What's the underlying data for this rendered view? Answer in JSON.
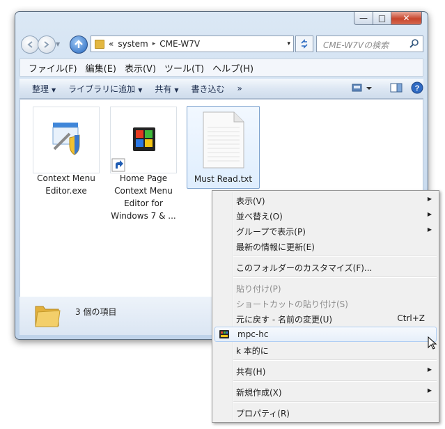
{
  "window": {
    "caption_buttons": {
      "min": "—",
      "max": "□",
      "close": "✕"
    }
  },
  "address": {
    "chevron": "«",
    "segments": [
      "system",
      "CME-W7V"
    ],
    "separator": "▸",
    "dropdown": "▾"
  },
  "search": {
    "placeholder": "CME-W7Vの検索"
  },
  "menubar": [
    "ファイル(F)",
    "編集(E)",
    "表示(V)",
    "ツール(T)",
    "ヘルプ(H)"
  ],
  "toolbar": {
    "items": [
      "整理",
      "ライブラリに追加",
      "共有",
      "書き込む"
    ],
    "more": "»",
    "arrow": "▼"
  },
  "files": [
    {
      "name": "Context Menu Editor.exe",
      "lines": [
        "Context Menu",
        "Editor.exe"
      ]
    },
    {
      "name": "Home Page Context Menu Editor for Windows 7 & ...",
      "lines": [
        "Home Page",
        "Context Menu",
        "Editor for",
        "Windows 7 & ..."
      ]
    },
    {
      "name": "Must Read.txt",
      "lines": [
        "Must Read.txt"
      ]
    }
  ],
  "details": {
    "count": "3 個の項目"
  },
  "context_menu": {
    "items": [
      {
        "label": "表示(V)",
        "submenu": "▶"
      },
      {
        "label": "並べ替え(O)",
        "submenu": "▶"
      },
      {
        "label": "グループで表示(P)",
        "submenu": "▶"
      },
      {
        "label": "最新の情報に更新(E)"
      },
      {
        "label": "このフォルダーのカスタマイズ(F)..."
      },
      {
        "label": "貼り付け(P)"
      },
      {
        "label": "ショートカットの貼り付け(S)"
      },
      {
        "label": "元に戻す - 名前の変更(U)",
        "shortcut": "Ctrl+Z"
      },
      {
        "label": "mpc-hc"
      },
      {
        "label": "k 本的に"
      },
      {
        "label": "共有(H)",
        "submenu": "▶"
      },
      {
        "label": "新規作成(X)",
        "submenu": "▶"
      },
      {
        "label": "プロパティ(R)"
      }
    ]
  }
}
